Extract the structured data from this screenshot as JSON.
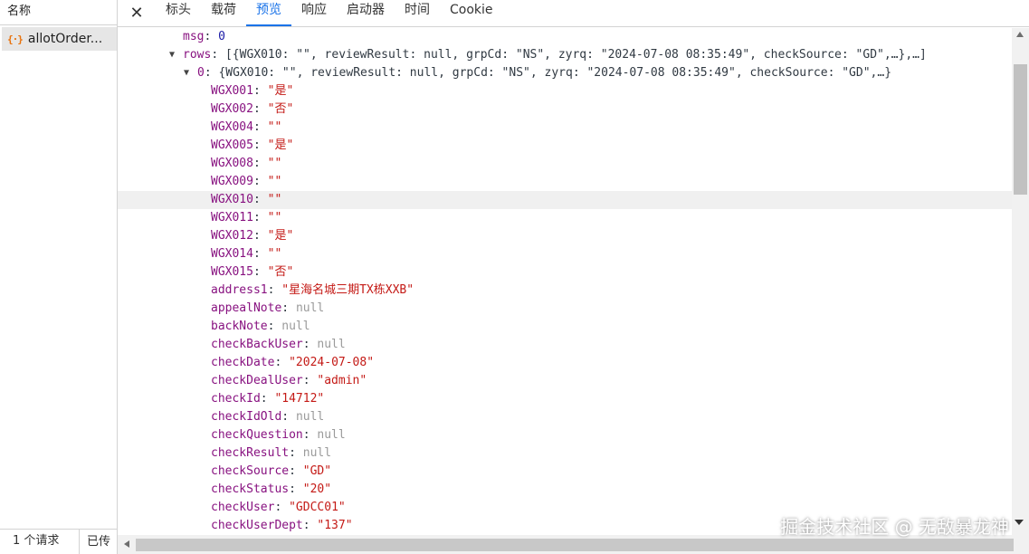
{
  "left_panel": {
    "header": "名称",
    "request_icon": "{·}",
    "request_name": "allotOrder...",
    "footer_count": "1 个请求",
    "footer_transfer": "已传"
  },
  "tabs": [
    {
      "label": "标头",
      "active": false
    },
    {
      "label": "载荷",
      "active": false
    },
    {
      "label": "预览",
      "active": true
    },
    {
      "label": "响应",
      "active": false
    },
    {
      "label": "启动器",
      "active": false
    },
    {
      "label": "时间",
      "active": false
    },
    {
      "label": "Cookie",
      "active": false
    }
  ],
  "close_icon": "close-icon",
  "preview": {
    "msg": {
      "key": "msg",
      "value": "0"
    },
    "rows_summary": {
      "key": "rows",
      "text": "[{WGX010: \"\", reviewResult: null, grpCd: \"NS\", zyrq: \"2024-07-08 08:35:49\", checkSource: \"GD\",…},…]"
    },
    "item0_summary": {
      "key": "0",
      "text": "{WGX010: \"\", reviewResult: null, grpCd: \"NS\", zyrq: \"2024-07-08 08:35:49\", checkSource: \"GD\",…}"
    },
    "fields": [
      {
        "key": "WGX001",
        "value": "\"是\"",
        "type": "str"
      },
      {
        "key": "WGX002",
        "value": "\"否\"",
        "type": "str"
      },
      {
        "key": "WGX004",
        "value": "\"\"",
        "type": "str"
      },
      {
        "key": "WGX005",
        "value": "\"是\"",
        "type": "str"
      },
      {
        "key": "WGX008",
        "value": "\"\"",
        "type": "str"
      },
      {
        "key": "WGX009",
        "value": "\"\"",
        "type": "str"
      },
      {
        "key": "WGX010",
        "value": "\"\"",
        "type": "str",
        "highlight": true
      },
      {
        "key": "WGX011",
        "value": "\"\"",
        "type": "str"
      },
      {
        "key": "WGX012",
        "value": "\"是\"",
        "type": "str"
      },
      {
        "key": "WGX014",
        "value": "\"\"",
        "type": "str"
      },
      {
        "key": "WGX015",
        "value": "\"否\"",
        "type": "str"
      },
      {
        "key": "address1",
        "value": "\"星海名城三期TX栋XXB\"",
        "type": "str"
      },
      {
        "key": "appealNote",
        "value": "null",
        "type": "null"
      },
      {
        "key": "backNote",
        "value": "null",
        "type": "null"
      },
      {
        "key": "checkBackUser",
        "value": "null",
        "type": "null"
      },
      {
        "key": "checkDate",
        "value": "\"2024-07-08\"",
        "type": "str"
      },
      {
        "key": "checkDealUser",
        "value": "\"admin\"",
        "type": "str"
      },
      {
        "key": "checkId",
        "value": "\"14712\"",
        "type": "str"
      },
      {
        "key": "checkIdOld",
        "value": "null",
        "type": "null"
      },
      {
        "key": "checkQuestion",
        "value": "null",
        "type": "null"
      },
      {
        "key": "checkResult",
        "value": "null",
        "type": "null"
      },
      {
        "key": "checkSource",
        "value": "\"GD\"",
        "type": "str"
      },
      {
        "key": "checkStatus",
        "value": "\"20\"",
        "type": "str"
      },
      {
        "key": "checkUser",
        "value": "\"GDCC01\"",
        "type": "str"
      },
      {
        "key": "checkUserDept",
        "value": "\"137\"",
        "type": "str"
      }
    ]
  },
  "watermark": "掘金技术社区 @ 无敌暴龙神"
}
